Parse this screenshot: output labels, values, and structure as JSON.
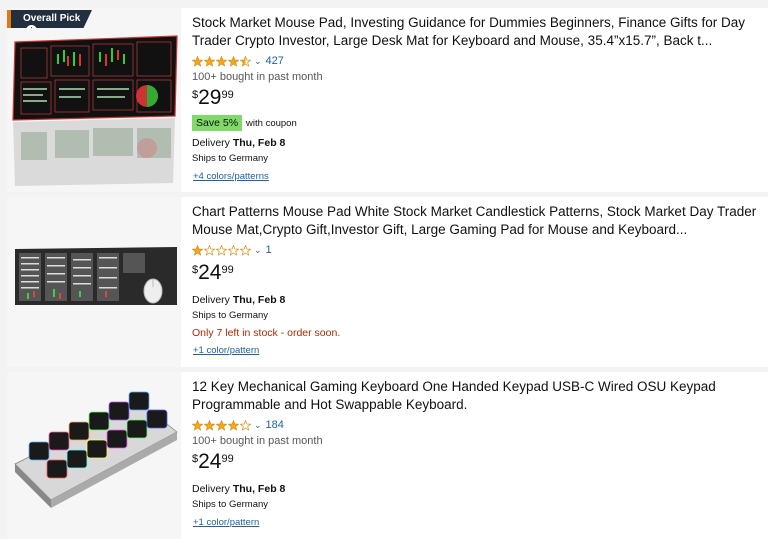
{
  "products": [
    {
      "badge": "Overall Pick",
      "badge_info_icon": "i",
      "title": "Stock Market Mouse Pad, Investing Guidance for Dummies Beginners, Finance Gifts for Day Trader Crypto Investor, Large Desk Mat for Keyboard and Mouse, 35.4”x15.7”, Back t...",
      "rating": 4.5,
      "review_count": "427",
      "bought": "100+ bought in past month",
      "price_symbol": "$",
      "price_whole": "29",
      "price_fraction": "99",
      "coupon": "Save 5%",
      "coupon_note": "with coupon",
      "delivery_label": "Delivery",
      "delivery_date": "Thu, Feb 8",
      "ships": "Ships to Germany",
      "variants": "+4 colors/patterns"
    },
    {
      "title": "Chart Patterns Mouse Pad White Stock Market Candlestick Patterns, Stock Market Day Trader Mouse Mat,Crypto Gift,Investor Gift, Large Gaming Pad for Mouse and Keyboard...",
      "rating": 1,
      "review_count": "1",
      "price_symbol": "$",
      "price_whole": "24",
      "price_fraction": "99",
      "delivery_label": "Delivery",
      "delivery_date": "Thu, Feb 8",
      "ships": "Ships to Germany",
      "stock": "Only 7 left in stock - order soon.",
      "variants": "+1 color/pattern"
    },
    {
      "title": "12 Key Mechanical Gaming Keyboard One Handed Keypad USB-C Wired OSU Keypad Programmable and Hot Swappable Keyboard.",
      "rating": 4,
      "review_count": "184",
      "bought": "100+ bought in past month",
      "price_symbol": "$",
      "price_whole": "24",
      "price_fraction": "99",
      "delivery_label": "Delivery",
      "delivery_date": "Thu, Feb 8",
      "ships": "Ships to Germany",
      "variants": "+1 color/pattern"
    }
  ],
  "colors": {
    "star": "#f5a623",
    "link": "#2162a1",
    "coupon": "#7fda69",
    "stock_warning": "#b12704"
  },
  "icons": {
    "rating_dropdown": "chevron-down-icon",
    "badge_info": "info-icon"
  }
}
